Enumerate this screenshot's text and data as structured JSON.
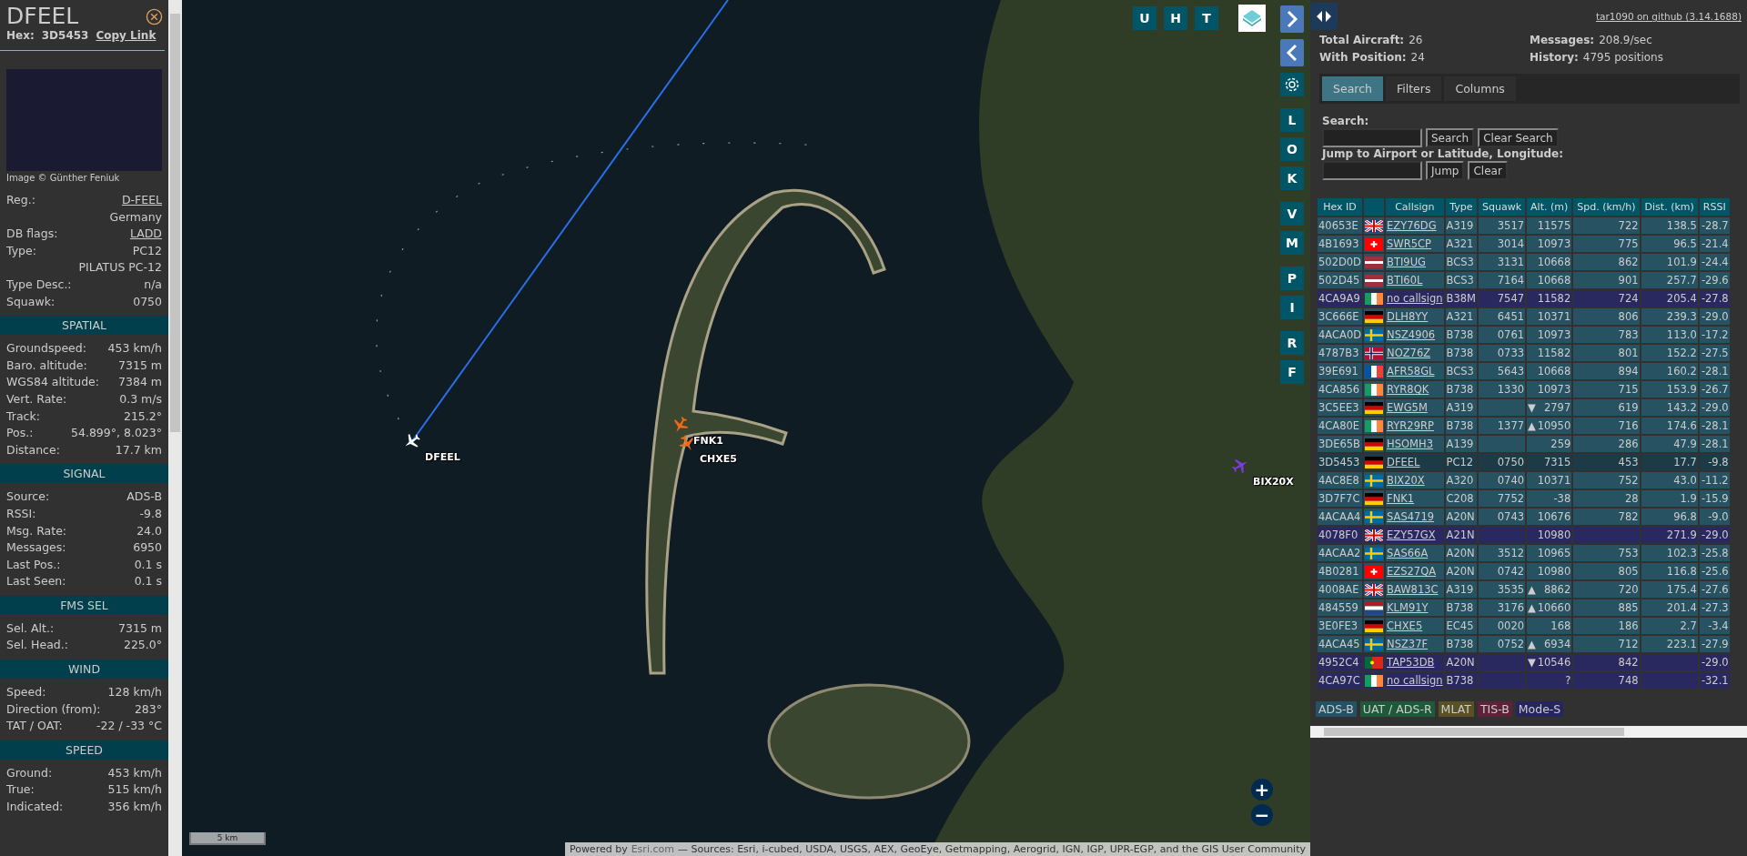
{
  "detail": {
    "callsign": "DFEEL",
    "hex_label": "Hex:",
    "hex": "3D5453",
    "copy_link": "Copy Link",
    "photo_credit": "Image © Günther Feniuk",
    "info": [
      {
        "label": "Reg.:",
        "value": "D-FEEL",
        "link": true
      },
      {
        "value": "Germany",
        "link": false
      },
      {
        "label": "DB flags:",
        "value": "LADD",
        "link": true
      },
      {
        "label": "Type:",
        "value": "PC12",
        "link": false
      },
      {
        "value": "PILATUS PC-12",
        "link": false
      },
      {
        "label": "Type Desc.:",
        "value": "n/a",
        "link": false
      },
      {
        "label": "Squawk:",
        "value": "0750",
        "link": false
      }
    ],
    "sections": [
      {
        "title": "SPATIAL",
        "rows": [
          {
            "label": "Groundspeed:",
            "value": "453 km/h"
          },
          {
            "label": "Baro. altitude:",
            "value": "7315 m"
          },
          {
            "label": "WGS84 altitude:",
            "value": "7384 m"
          },
          {
            "label": "Vert. Rate:",
            "value": "0.3 m/s"
          },
          {
            "label": "Track:",
            "value": "215.2°"
          },
          {
            "label": "Pos.:",
            "value": "54.899°, 8.023°"
          },
          {
            "label": "Distance:",
            "value": "17.7 km"
          }
        ]
      },
      {
        "title": "SIGNAL",
        "rows": [
          {
            "label": "Source:",
            "value": "ADS-B"
          },
          {
            "label": "RSSI:",
            "value": "-9.8"
          },
          {
            "label": "Msg. Rate:",
            "value": "24.0"
          },
          {
            "label": "Messages:",
            "value": "6950"
          },
          {
            "label": "Last Pos.:",
            "value": "0.1 s"
          },
          {
            "label": "Last Seen:",
            "value": "0.1 s"
          }
        ]
      },
      {
        "title": "FMS SEL",
        "rows": [
          {
            "label": "Sel. Alt.:",
            "value": "7315 m"
          },
          {
            "label": "Sel. Head.:",
            "value": "225.0°"
          }
        ]
      },
      {
        "title": "WIND",
        "rows": [
          {
            "label": "Speed:",
            "value": "128 km/h"
          },
          {
            "label": "Direction (from):",
            "value": "283°"
          },
          {
            "label": "TAT / OAT:",
            "value": "-22 / -33 °C"
          }
        ]
      },
      {
        "title": "SPEED",
        "rows": [
          {
            "label": "Ground:",
            "value": "453 km/h"
          },
          {
            "label": "True:",
            "value": "515 km/h"
          },
          {
            "label": "Indicated:",
            "value": "356 km/h"
          }
        ]
      }
    ]
  },
  "map": {
    "top_buttons": [
      "U",
      "H",
      "T"
    ],
    "side_groups": [
      [
        "L",
        "O",
        "K"
      ],
      [
        "V",
        "M"
      ],
      [
        "P",
        "I"
      ],
      [
        "R",
        "F"
      ]
    ],
    "aircraft": [
      {
        "label": "DFEEL",
        "color": "#ffffff"
      },
      {
        "label": "FNK1",
        "color": "#f06a1a"
      },
      {
        "label": "CHXE5",
        "color": "#f06a1a"
      },
      {
        "label": "BIX20X",
        "color": "#7a3cdc"
      }
    ],
    "scale": "5 km",
    "zoom_in": "+",
    "zoom_out": "−",
    "attribution": {
      "prefix": "Powered by",
      "link": "Esri.com",
      "text": "— Sources: Esri, i-cubed, USDA, USGS, AEX, GeoEye, Getmapping, Aerogrid, IGN, IGP, UPR-EGP, and the GIS User Community"
    }
  },
  "panel": {
    "github_link": "tar1090 on github (3.14.1688)",
    "stats": [
      {
        "label": "Total Aircraft:",
        "value": "26"
      },
      {
        "label": "Messages:",
        "value": "208.9/sec"
      },
      {
        "label": "With Position:",
        "value": "24"
      },
      {
        "label": "History:",
        "value": "4795 positions"
      }
    ],
    "tabs": [
      {
        "label": "Search",
        "selected": true
      },
      {
        "label": "Filters",
        "selected": false
      },
      {
        "label": "Columns",
        "selected": false
      }
    ],
    "search": {
      "label": "Search:",
      "button": "Search",
      "clear": "Clear Search",
      "jump_label": "Jump to Airport or Latitude, Longitude:",
      "jump": "Jump",
      "jump_clear": "Clear"
    },
    "table": {
      "columns": [
        "Hex ID",
        "",
        "Callsign",
        "Type",
        "Squawk",
        "Alt. (m)",
        "Spd. (km/h)",
        "Dist. (km)",
        "RSSI"
      ],
      "rows": [
        {
          "hex": "40653E",
          "flag": {
            "kind": "gb"
          },
          "callsign": "EZY76DG",
          "type": "A319",
          "squawk": "3517",
          "alt": "11575",
          "speed": "722",
          "dist": "138.5",
          "rssi": "-28.7",
          "kind": "adsb",
          "selected": false
        },
        {
          "hex": "4B1693",
          "flag": {
            "kind": "ch"
          },
          "callsign": "SWR5CP",
          "type": "A321",
          "squawk": "3014",
          "alt": "10973",
          "speed": "775",
          "dist": "96.5",
          "rssi": "-21.4",
          "kind": "adsb",
          "selected": false
        },
        {
          "hex": "502D0D",
          "flag": {
            "kind": "lv"
          },
          "callsign": "BTI9UG",
          "type": "BCS3",
          "squawk": "3131",
          "alt": "10668",
          "speed": "862",
          "dist": "101.9",
          "rssi": "-24.4",
          "kind": "adsb",
          "selected": false
        },
        {
          "hex": "502D45",
          "flag": {
            "kind": "lv"
          },
          "callsign": "BTI60L",
          "type": "BCS3",
          "squawk": "7164",
          "alt": "10668",
          "speed": "901",
          "dist": "257.7",
          "rssi": "-29.6",
          "kind": "adsb",
          "selected": false
        },
        {
          "hex": "4CA9A9",
          "flag": {
            "kind": "ie"
          },
          "callsign": "no callsign",
          "type": "B38M",
          "squawk": "7547",
          "alt": "11582",
          "speed": "724",
          "dist": "205.4",
          "rssi": "-27.8",
          "kind": "modes",
          "selected": false
        },
        {
          "hex": "3C666E",
          "flag": {
            "kind": "de"
          },
          "callsign": "DLH8YY",
          "type": "A321",
          "squawk": "6451",
          "alt": "10371",
          "speed": "806",
          "dist": "239.3",
          "rssi": "-29.0",
          "kind": "adsb",
          "selected": false
        },
        {
          "hex": "4ACA0D",
          "flag": {
            "kind": "se"
          },
          "callsign": "NSZ4906",
          "type": "B738",
          "squawk": "0761",
          "alt": "10973",
          "speed": "783",
          "dist": "113.0",
          "rssi": "-17.2",
          "kind": "adsb",
          "selected": false
        },
        {
          "hex": "4787B3",
          "flag": {
            "kind": "no"
          },
          "callsign": "NOZ76Z",
          "type": "B738",
          "squawk": "0733",
          "alt": "11582",
          "speed": "801",
          "dist": "152.2",
          "rssi": "-27.5",
          "kind": "adsb",
          "selected": false
        },
        {
          "hex": "39E691",
          "flag": {
            "kind": "fr"
          },
          "callsign": "AFR58GL",
          "type": "BCS3",
          "squawk": "5643",
          "alt": "10668",
          "speed": "894",
          "dist": "160.2",
          "rssi": "-28.1",
          "kind": "adsb",
          "selected": false
        },
        {
          "hex": "4CA856",
          "flag": {
            "kind": "ie"
          },
          "callsign": "RYR8QK",
          "type": "B738",
          "squawk": "1330",
          "alt": "10973",
          "speed": "715",
          "dist": "153.9",
          "rssi": "-26.7",
          "kind": "adsb",
          "selected": false
        },
        {
          "hex": "3C5EE3",
          "flag": {
            "kind": "de"
          },
          "callsign": "EWG5M",
          "type": "A319",
          "trend": "▼",
          "alt": "2797",
          "speed": "619",
          "dist": "143.2",
          "rssi": "-29.0",
          "kind": "adsb",
          "selected": false
        },
        {
          "hex": "4CA80E",
          "flag": {
            "kind": "ie"
          },
          "callsign": "RYR29RP",
          "type": "B738",
          "squawk": "1377",
          "trend": "▲",
          "alt": "10950",
          "speed": "716",
          "dist": "174.6",
          "rssi": "-28.1",
          "kind": "adsb",
          "selected": false
        },
        {
          "hex": "3DE65B",
          "flag": {
            "kind": "de"
          },
          "callsign": "HSOMH3",
          "type": "A139",
          "alt": "259",
          "speed": "286",
          "dist": "47.9",
          "rssi": "-28.1",
          "kind": "adsb",
          "selected": false
        },
        {
          "hex": "3D5453",
          "flag": {
            "kind": "de"
          },
          "callsign": "DFEEL",
          "type": "PC12",
          "squawk": "0750",
          "alt": "7315",
          "speed": "453",
          "dist": "17.7",
          "rssi": "-9.8",
          "kind": "adsb",
          "selected": true
        },
        {
          "hex": "4AC8E8",
          "flag": {
            "kind": "se"
          },
          "callsign": "BIX20X",
          "type": "A320",
          "squawk": "0740",
          "alt": "10371",
          "speed": "752",
          "dist": "43.0",
          "rssi": "-11.2",
          "kind": "adsb",
          "selected": false
        },
        {
          "hex": "3D7F7C",
          "flag": {
            "kind": "de"
          },
          "callsign": "FNK1",
          "type": "C208",
          "squawk": "7752",
          "alt": "-38",
          "speed": "28",
          "dist": "1.9",
          "rssi": "-15.9",
          "kind": "adsb",
          "selected": false
        },
        {
          "hex": "4ACAA4",
          "flag": {
            "kind": "se"
          },
          "callsign": "SAS4719",
          "type": "A20N",
          "squawk": "0743",
          "alt": "10676",
          "speed": "782",
          "dist": "96.8",
          "rssi": "-9.0",
          "kind": "adsb",
          "selected": false
        },
        {
          "hex": "4078F0",
          "flag": {
            "kind": "gb"
          },
          "callsign": "EZY57GX",
          "type": "A21N",
          "alt": "10980",
          "dist": "271.9",
          "rssi": "-29.0",
          "kind": "modes",
          "selected": false
        },
        {
          "hex": "4ACAA2",
          "flag": {
            "kind": "se"
          },
          "callsign": "SAS66A",
          "type": "A20N",
          "squawk": "3512",
          "alt": "10965",
          "speed": "753",
          "dist": "102.3",
          "rssi": "-25.8",
          "kind": "adsb",
          "selected": false
        },
        {
          "hex": "4B0281",
          "flag": {
            "kind": "ch"
          },
          "callsign": "EZS27QA",
          "type": "A20N",
          "squawk": "0742",
          "alt": "10980",
          "speed": "805",
          "dist": "116.8",
          "rssi": "-25.6",
          "kind": "adsb",
          "selected": false
        },
        {
          "hex": "4008AE",
          "flag": {
            "kind": "gb"
          },
          "callsign": "BAW813C",
          "type": "A319",
          "squawk": "3535",
          "trend": "▲",
          "alt": "8862",
          "speed": "720",
          "dist": "175.4",
          "rssi": "-27.6",
          "kind": "adsb",
          "selected": false
        },
        {
          "hex": "484559",
          "flag": {
            "kind": "nl"
          },
          "callsign": "KLM91Y",
          "type": "B738",
          "squawk": "3176",
          "trend": "▲",
          "alt": "10660",
          "speed": "885",
          "dist": "201.4",
          "rssi": "-27.3",
          "kind": "adsb",
          "selected": false
        },
        {
          "hex": "3E0FE3",
          "flag": {
            "kind": "de"
          },
          "callsign": "CHXE5",
          "type": "EC45",
          "squawk": "0020",
          "alt": "168",
          "speed": "186",
          "dist": "2.7",
          "rssi": "-3.4",
          "kind": "adsb",
          "selected": false
        },
        {
          "hex": "4ACA45",
          "flag": {
            "kind": "se"
          },
          "callsign": "NSZ37F",
          "type": "B738",
          "squawk": "0752",
          "trend": "▲",
          "alt": "6934",
          "speed": "712",
          "dist": "223.1",
          "rssi": "-27.9",
          "kind": "adsb",
          "selected": false
        },
        {
          "hex": "4952C4",
          "flag": {
            "kind": "pt"
          },
          "callsign": "TAP53DB",
          "type": "A20N",
          "trend": "▼",
          "alt": "10546",
          "speed": "842",
          "rssi": "-29.0",
          "kind": "modes",
          "selected": false
        },
        {
          "hex": "4CA97C",
          "flag": {
            "kind": "ie"
          },
          "callsign": "no callsign",
          "type": "B738",
          "alt": "?",
          "speed": "748",
          "rssi": "-32.1",
          "kind": "modes",
          "selected": false
        }
      ]
    },
    "legend": [
      {
        "label": "ADS-B",
        "color": "#245264"
      },
      {
        "label": "UAT / ADS-R",
        "color": "#1e5a3a"
      },
      {
        "label": "MLAT",
        "color": "#5a5026"
      },
      {
        "label": "TIS-B",
        "color": "#5e2238"
      },
      {
        "label": "Mode-S",
        "color": "#26255e"
      }
    ]
  }
}
